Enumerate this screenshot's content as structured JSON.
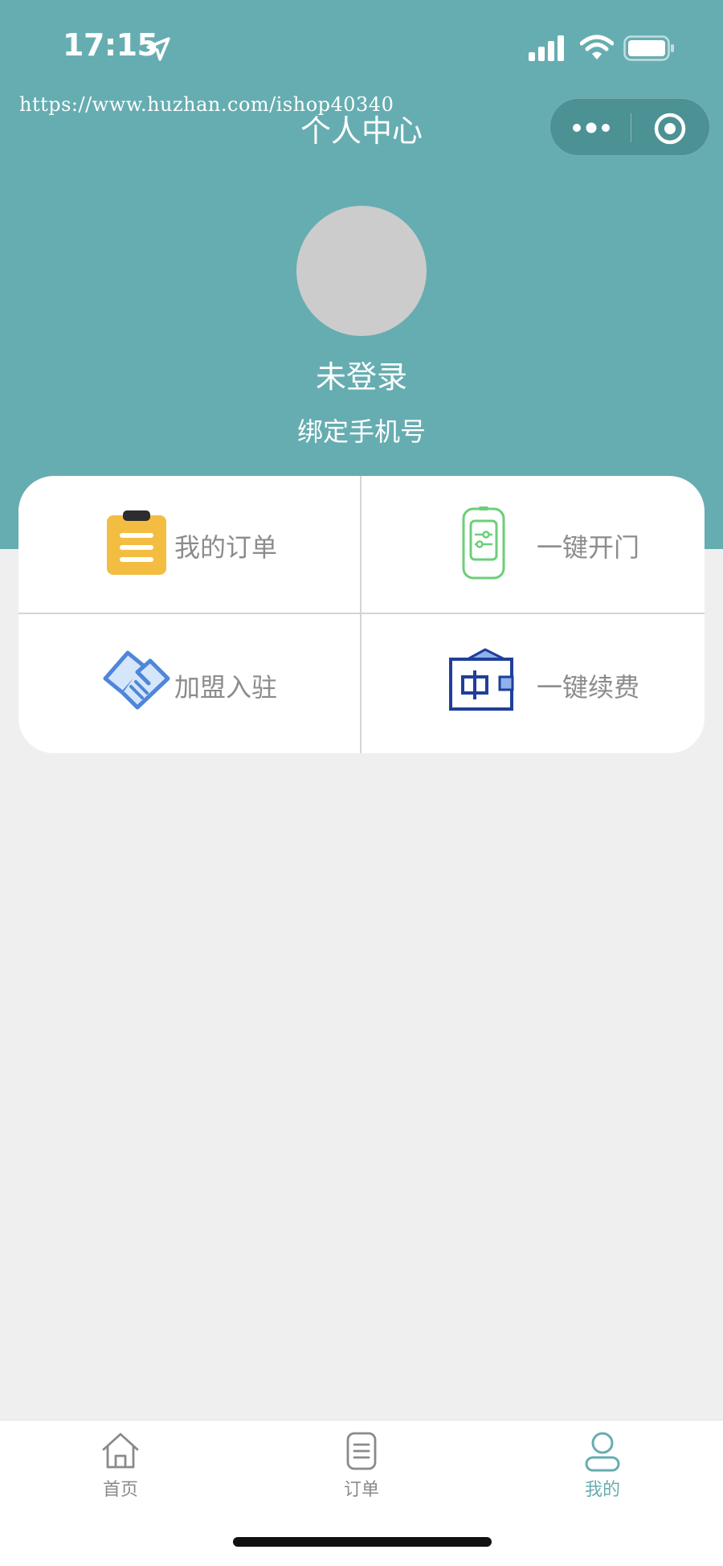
{
  "status_bar": {
    "time": "17:15"
  },
  "watermark": "https://www.huzhan.com/ishop40340",
  "header": {
    "title": "个人中心"
  },
  "profile": {
    "login_status": "未登录",
    "bind_phone": "绑定手机号"
  },
  "menu": {
    "items": [
      {
        "label": "我的订单",
        "icon": "clipboard-icon"
      },
      {
        "label": "一键开门",
        "icon": "door-remote-icon"
      },
      {
        "label": "加盟入驻",
        "icon": "handshake-icon"
      },
      {
        "label": "一键续费",
        "icon": "wallet-icon"
      }
    ]
  },
  "tabbar": {
    "tabs": [
      {
        "label": "首页",
        "icon": "home-icon"
      },
      {
        "label": "订单",
        "icon": "document-icon"
      },
      {
        "label": "我的",
        "icon": "user-icon",
        "active": true
      }
    ]
  },
  "colors": {
    "accent": "#66adb1",
    "page_bg": "#efefef",
    "label_gray": "#8c8c8c"
  }
}
